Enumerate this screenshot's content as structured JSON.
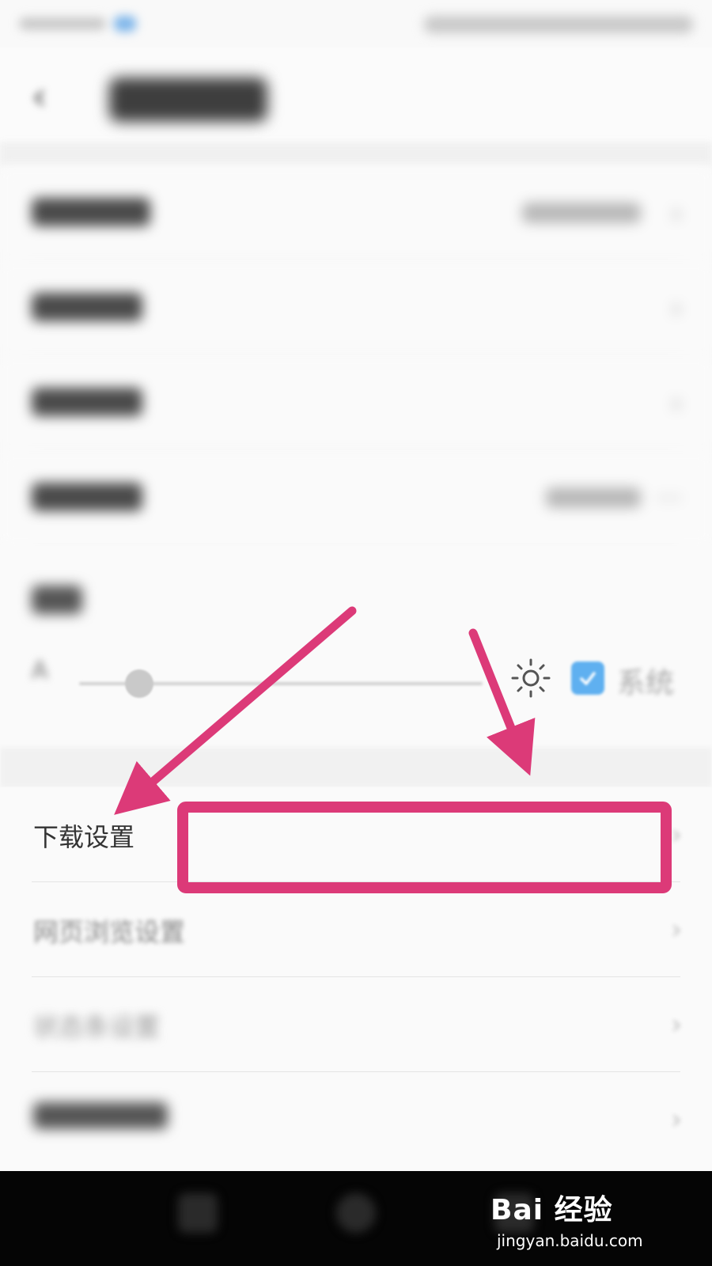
{
  "header": {
    "back_icon": "chevron-left-icon",
    "title": ""
  },
  "settings_blurred_rows": 4,
  "brightness": {
    "label": "",
    "small_label": "A",
    "slider_level": 0.14,
    "auto_checked": true,
    "auto_label": "系统"
  },
  "list": [
    {
      "label": "下载设置"
    },
    {
      "label": "网页浏览设置"
    },
    {
      "label": "状态条设置"
    },
    {
      "label": ""
    }
  ],
  "watermark": {
    "main": "Bai 经验",
    "sub": "jingyan.baidu.com"
  },
  "annotation_colors": {
    "arrow": "#dc3a78",
    "highlight_box": "#dc3a78"
  }
}
